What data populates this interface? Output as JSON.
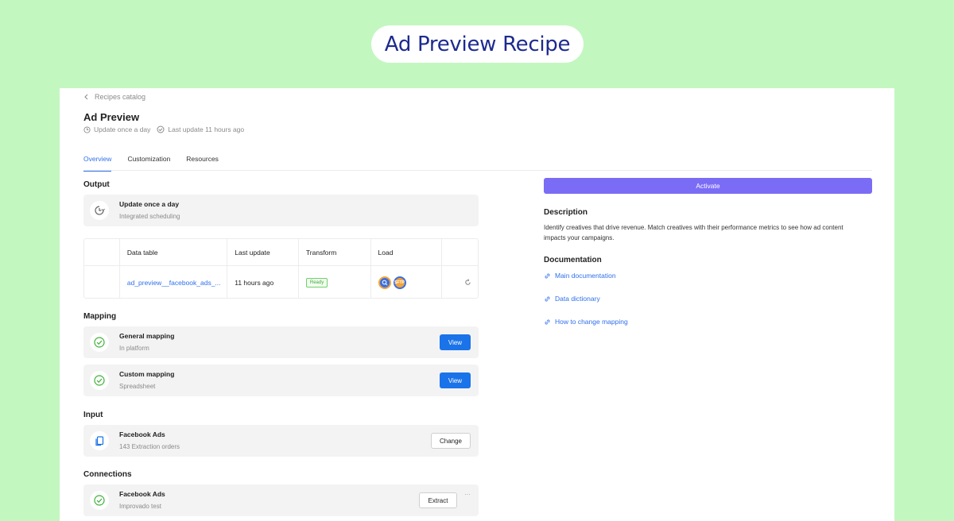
{
  "hero": {
    "title": "Ad Preview Recipe"
  },
  "breadcrumb": {
    "label": "Recipes catalog"
  },
  "header": {
    "title": "Ad Preview",
    "frequency": "Update once a day",
    "last_update": "Last update 11 hours ago"
  },
  "tabs": [
    "Overview",
    "Customization",
    "Resources"
  ],
  "output": {
    "section": "Output",
    "card": {
      "title": "Update once a day",
      "subtitle": "Integrated scheduling"
    }
  },
  "table": {
    "headers": [
      "Data table",
      "Last update",
      "Transform",
      "Load"
    ],
    "row": {
      "data_table": "ad_preview__facebook_ads_...",
      "last_update": "11 hours ago",
      "transform": "Ready",
      "load_icons": [
        "bigquery-icon",
        "sftp-icon"
      ],
      "load_sftp_label": "SFTP"
    }
  },
  "mapping": {
    "section": "Mapping",
    "items": [
      {
        "title": "General mapping",
        "subtitle": "In platform",
        "button": "View"
      },
      {
        "title": "Custom mapping",
        "subtitle": "Spreadsheet",
        "button": "View"
      }
    ]
  },
  "input": {
    "section": "Input",
    "card": {
      "title": "Facebook Ads",
      "subtitle": "143 Extraction orders",
      "button": "Change"
    }
  },
  "connections": {
    "section": "Connections",
    "card": {
      "title": "Facebook Ads",
      "subtitle": "Improvado test",
      "button": "Extract",
      "more": "···"
    }
  },
  "sidebar": {
    "activate": "Activate",
    "description_title": "Description",
    "description": "Identify creatives that drive revenue. Match creatives with their performance metrics to see how ad content impacts your campaigns.",
    "documentation_title": "Documentation",
    "links": [
      "Main documentation",
      "Data dictionary",
      "How to change mapping"
    ]
  },
  "colors": {
    "background": "#c3f7c0",
    "accent": "#2f6fed",
    "activate": "#7b6cf6",
    "primary_button": "#1a73e8",
    "success": "#44a63f"
  }
}
